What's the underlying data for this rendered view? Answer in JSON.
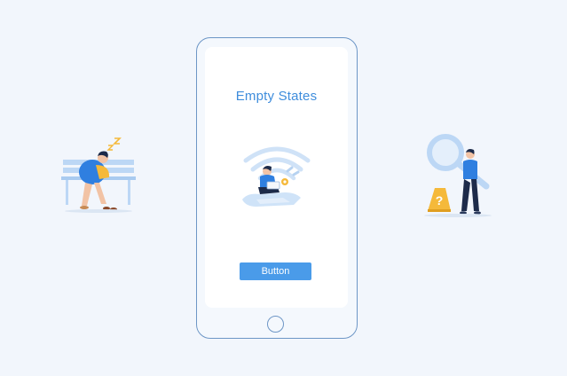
{
  "screen": {
    "title": "Empty States",
    "button_label": "Button"
  },
  "illustrations": {
    "left": "sleeping-person-on-bench-icon",
    "center": "person-with-weak-wifi-icon",
    "right": "person-with-magnifier-icon"
  },
  "colors": {
    "background": "#f2f6fc",
    "phone_outline": "#6d96c6",
    "title": "#3f8ddc",
    "button": "#4a9be9",
    "figure_blue": "#2f7fe0",
    "accent_yellow": "#f5b93a"
  }
}
